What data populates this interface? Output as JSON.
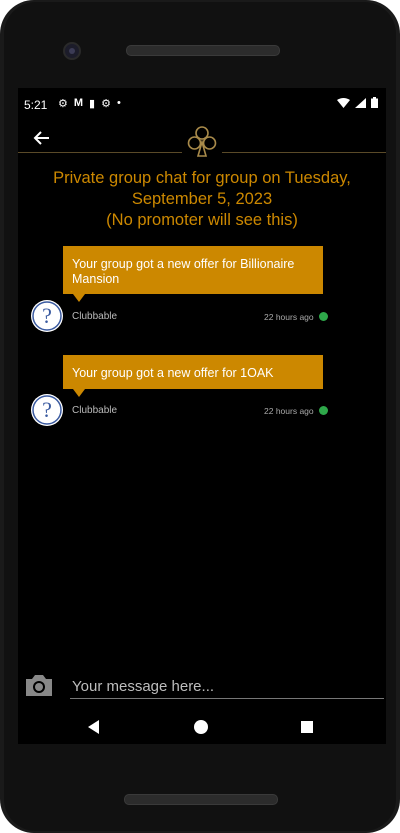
{
  "status_bar": {
    "time": "5:21"
  },
  "header": {
    "title_line1": "Private group chat for group on Tuesday,",
    "title_line2": "September 5, 2023",
    "title_line3": "(No promoter will see this)"
  },
  "messages": [
    {
      "text": "Your group got a new offer for Billionaire Mansion",
      "sender": "Clubbable",
      "time_ago": "22 hours ago"
    },
    {
      "text": "Your group got a new offer for 1OAK",
      "sender": "Clubbable",
      "time_ago": "22 hours ago"
    }
  ],
  "composer": {
    "placeholder": "Your message here..."
  },
  "colors": {
    "accent": "#cc8800",
    "background": "#000000",
    "read_check": "#2ea84a"
  },
  "icons": [
    "settings-gear-icon",
    "gmail-icon",
    "sd-card-icon",
    "settings-gear-icon",
    "dot-icon",
    "wifi-icon",
    "signal-icon",
    "battery-icon",
    "back-arrow-icon",
    "club-suit-icon",
    "question-avatar-icon",
    "check-icon",
    "camera-icon",
    "nav-back-icon",
    "nav-home-icon",
    "nav-recent-icon"
  ]
}
